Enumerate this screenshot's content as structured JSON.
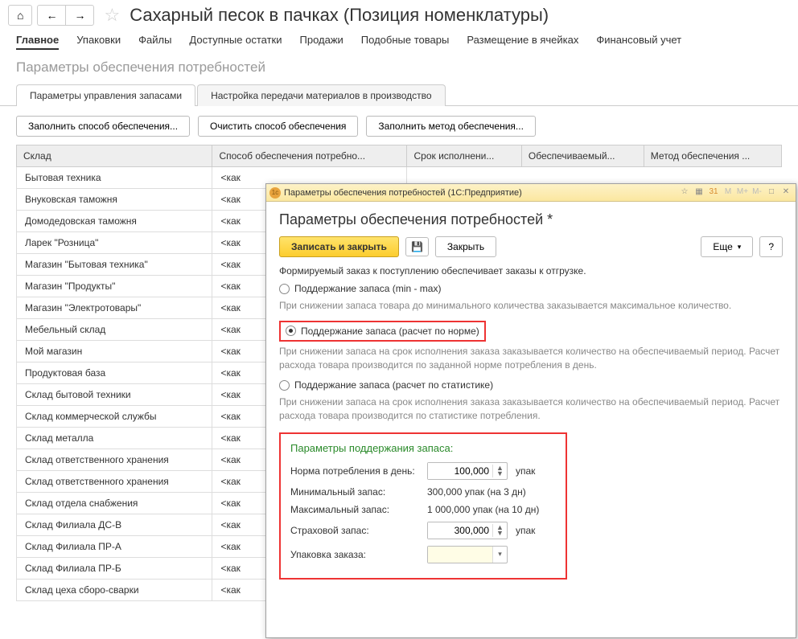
{
  "header": {
    "title": "Сахарный песок в пачках (Позиция номенклатуры)"
  },
  "main_tabs": [
    "Главное",
    "Упаковки",
    "Файлы",
    "Доступные остатки",
    "Продажи",
    "Подобные товары",
    "Размещение в ячейках",
    "Финансовый учет"
  ],
  "subtitle": "Параметры обеспечения потребностей",
  "sub_tabs": [
    "Параметры управления запасами",
    "Настройка передачи материалов в производство"
  ],
  "action_buttons": [
    "Заполнить способ обеспечения...",
    "Очистить способ обеспечения",
    "Заполнить метод обеспечения..."
  ],
  "table": {
    "headers": [
      "Склад",
      "Способ обеспечения потребно...",
      "Срок исполнени...",
      "Обеспечиваемый...",
      "Метод обеспечения ..."
    ],
    "rows": [
      {
        "sklad": "Бытовая техника",
        "sposob": "<как"
      },
      {
        "sklad": "Внуковская таможня",
        "sposob": "<как"
      },
      {
        "sklad": "Домодедовская таможня",
        "sposob": "<как"
      },
      {
        "sklad": "Ларек \"Розница\"",
        "sposob": "<как"
      },
      {
        "sklad": "Магазин \"Бытовая техника\"",
        "sposob": "<как"
      },
      {
        "sklad": "Магазин \"Продукты\"",
        "sposob": "<как"
      },
      {
        "sklad": "Магазин \"Электротовары\"",
        "sposob": "<как"
      },
      {
        "sklad": "Мебельный склад",
        "sposob": "<как"
      },
      {
        "sklad": "Мой магазин",
        "sposob": "<как"
      },
      {
        "sklad": "Продуктовая база",
        "sposob": "<как"
      },
      {
        "sklad": "Склад бытовой техники",
        "sposob": "<как"
      },
      {
        "sklad": "Склад коммерческой службы",
        "sposob": "<как"
      },
      {
        "sklad": "Склад металла",
        "sposob": "<как"
      },
      {
        "sklad": "Склад ответственного хранения",
        "sposob": "<как"
      },
      {
        "sklad": "Склад ответственного хранения",
        "sposob": "<как"
      },
      {
        "sklad": "Склад отдела снабжения",
        "sposob": "<как"
      },
      {
        "sklad": "Склад Филиала ДС-В",
        "sposob": "<как"
      },
      {
        "sklad": "Склад Филиала ПР-А",
        "sposob": "<как"
      },
      {
        "sklad": "Склад Филиала ПР-Б",
        "sposob": "<как"
      },
      {
        "sklad": "Склад цеха сборо-сварки",
        "sposob": "<как"
      }
    ]
  },
  "dialog": {
    "title": "Параметры обеспечения потребностей (1С:Предприятие)",
    "heading": "Параметры обеспечения потребностей *",
    "btn_save_close": "Записать и закрыть",
    "btn_close": "Закрыть",
    "btn_more": "Еще",
    "btn_help": "?",
    "desc1": "Формируемый заказ к поступлению обеспечивает заказы к отгрузке.",
    "radio1": "Поддержание запаса (min - max)",
    "hint1": "При снижении запаса товара до минимального количества заказывается максимальное количество.",
    "radio2": "Поддержание запаса (расчет по норме)",
    "hint2": "При снижении запаса на срок исполнения заказа заказывается количество на обеспечиваемый период. Расчет расхода товара производится по заданной норме потребления в день.",
    "radio3": "Поддержание запаса (расчет по статистике)",
    "hint3": "При снижении запаса на срок исполнения заказа заказывается количество на обеспечиваемый период. Расчет расхода товара производится по статистике потребления.",
    "params_title": "Параметры поддержания запаса:",
    "p_norma_label": "Норма потребления в день:",
    "p_norma_value": "100,000",
    "p_norma_unit": "упак",
    "p_min_label": "Минимальный запас:",
    "p_min_value": "300,000 упак (на 3 дн)",
    "p_max_label": "Максимальный запас:",
    "p_max_value": "1 000,000 упак (на 10 дн)",
    "p_strah_label": "Страховой запас:",
    "p_strah_value": "300,000",
    "p_strah_unit": "упак",
    "p_upak_label": "Упаковка заказа:",
    "p_upak_value": ""
  }
}
